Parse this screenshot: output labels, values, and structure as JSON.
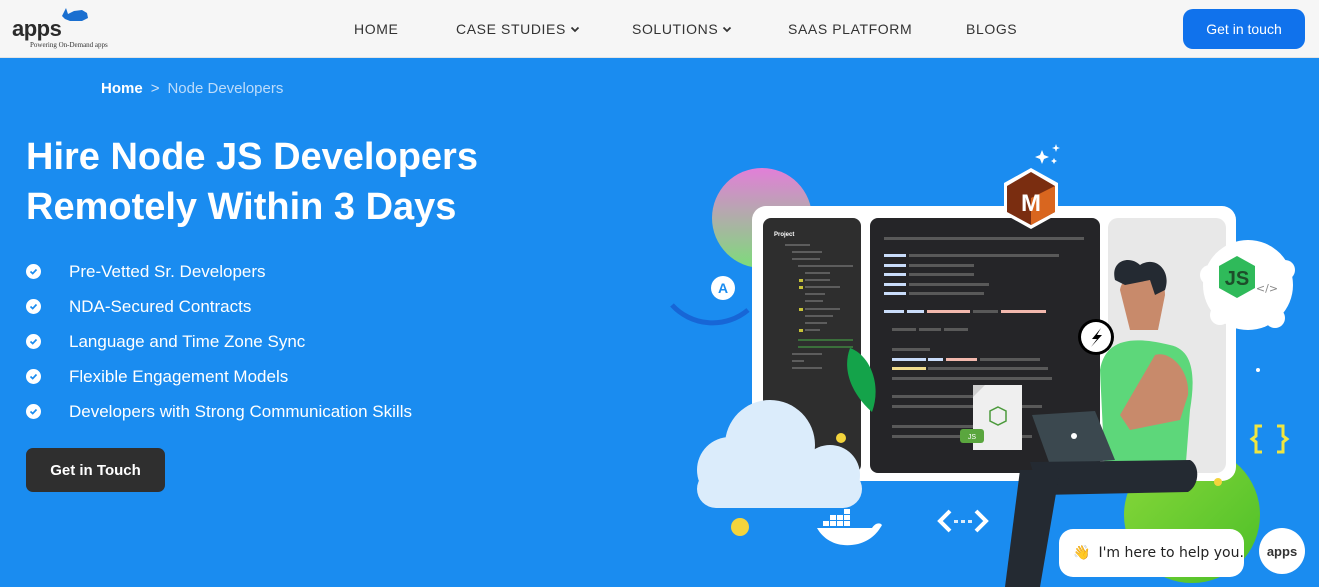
{
  "header": {
    "logo": {
      "word": "apps",
      "tagline": "Powering On-Demand apps"
    },
    "nav": [
      {
        "label": "HOME",
        "has_dropdown": false
      },
      {
        "label": "CASE STUDIES",
        "has_dropdown": true
      },
      {
        "label": "SOLUTIONS",
        "has_dropdown": true
      },
      {
        "label": "SAAS PLATFORM",
        "has_dropdown": false
      },
      {
        "label": "BLOGS",
        "has_dropdown": false
      }
    ],
    "cta_label": "Get in touch"
  },
  "breadcrumb": {
    "home": "Home",
    "separator": ">",
    "current": "Node Developers"
  },
  "hero": {
    "title_line1": "Hire Node JS Developers",
    "title_line2": "Remotely Within 3 Days",
    "features": [
      "Pre-Vetted Sr. Developers",
      "NDA-Secured Contracts",
      "Language and Time Zone Sync",
      "Flexible Engagement Models",
      "Developers with Strong Communication Skills"
    ],
    "cta_label": "Get in Touch"
  },
  "illustration": {
    "project_panel_title": "Project",
    "badges": {
      "m_badge": "M",
      "js_badge": "JS",
      "js_file_label": "JS",
      "code_tag": "</>",
      "a_badge": "A"
    }
  },
  "chat": {
    "emoji": "👋",
    "message": "I'm here to help you.",
    "avatar_label": "apps"
  },
  "colors": {
    "hero_bg": "#1a8cf0",
    "header_bg": "#f6f6f6",
    "primary_button": "#1072ec",
    "dark_button": "#2f2f2f"
  }
}
